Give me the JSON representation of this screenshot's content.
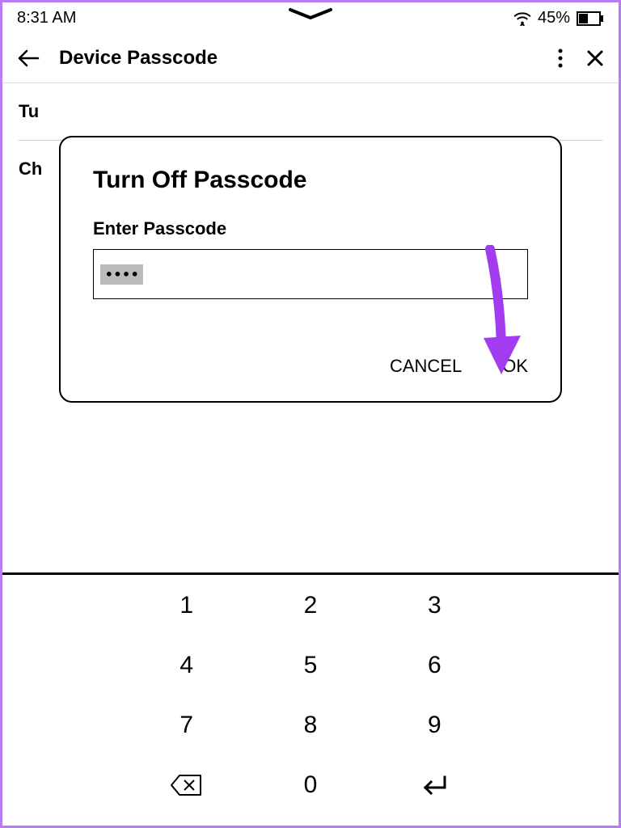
{
  "status_bar": {
    "time": "8:31 AM",
    "battery_pct": "45%"
  },
  "header": {
    "title": "Device Passcode"
  },
  "page": {
    "items": [
      {
        "label_partial": "Tu"
      },
      {
        "label_partial": "Ch"
      }
    ]
  },
  "modal": {
    "title": "Turn Off Passcode",
    "label": "Enter Passcode",
    "masked_value": "••••",
    "cancel_label": "CANCEL",
    "ok_label": "OK"
  },
  "keypad": {
    "keys": [
      "1",
      "2",
      "3",
      "4",
      "5",
      "6",
      "7",
      "8",
      "9"
    ],
    "zero": "0"
  }
}
